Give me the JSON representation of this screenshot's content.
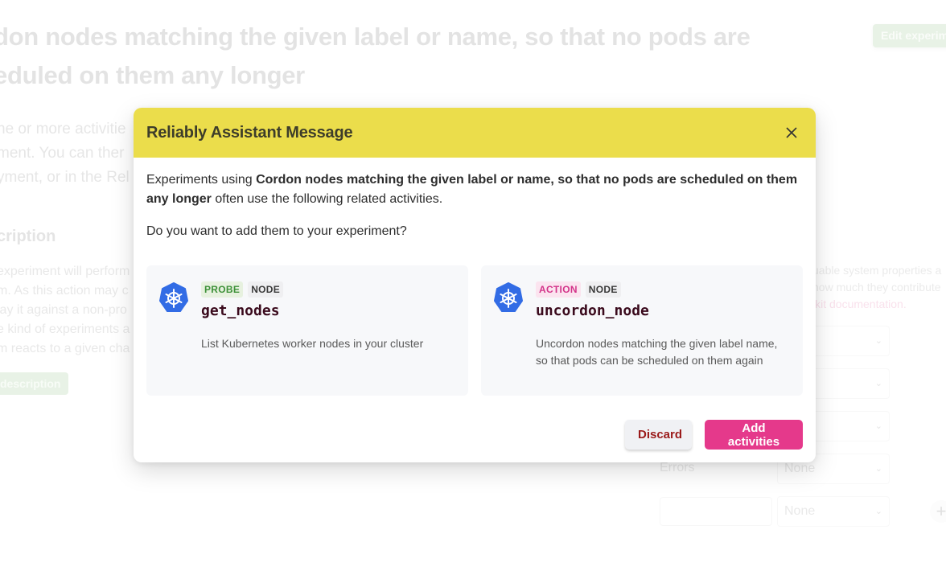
{
  "background": {
    "title": "Cordon nodes matching the given label or name, so that no pods are scheduled on them any longer",
    "title_visible_line1": "don nodes matching the given label or name, so that no pods are",
    "title_visible_line2": "eduled on them any longer",
    "edit_button": "Edit experim",
    "intro_lines": [
      "ne or more activitie",
      "ment. You can ther",
      "yment, or in the Rel"
    ],
    "description_heading": "cription",
    "description_lines": [
      "experiment will perform",
      "m. As this action may c",
      "lay it against a non-pro",
      "e kind of experiments a",
      "m reacts to a given cha"
    ],
    "description_button": "description",
    "right_text_lines": [
      "uable system properties a",
      "how much they contribute"
    ],
    "right_link": "lkit documentation.",
    "errors_label": "Errors",
    "select_values": [
      "",
      "",
      "",
      "None",
      "None"
    ],
    "add_icon": "plus-icon"
  },
  "modal": {
    "title": "Reliably Assistant Message",
    "close_icon": "close-icon",
    "message_prefix": "Experiments using ",
    "message_bold": "Cordon nodes matching the given label or name, so that no pods are scheduled on them any longer",
    "message_suffix": " often use the following related activities.",
    "question": "Do you want to add them to your experiment?",
    "activities": [
      {
        "icon": "kubernetes-icon",
        "type": "PROBE",
        "category": "NODE",
        "name": "get_nodes",
        "description": "List Kubernetes worker nodes in your cluster"
      },
      {
        "icon": "kubernetes-icon",
        "type": "ACTION",
        "category": "NODE",
        "name": "uncordon_node",
        "description": "Uncordon nodes matching the given label name, so that pods can be scheduled on them again"
      }
    ],
    "discard_label": "Discard",
    "add_label": "Add activities"
  },
  "colors": {
    "header_yellow": "#ebdd4b",
    "primary_pink": "#e5398b",
    "probe_green": "#3e9139",
    "action_pink": "#d3348a",
    "kubernetes_blue": "#326ce5",
    "discard_red": "#9a1a1a"
  }
}
